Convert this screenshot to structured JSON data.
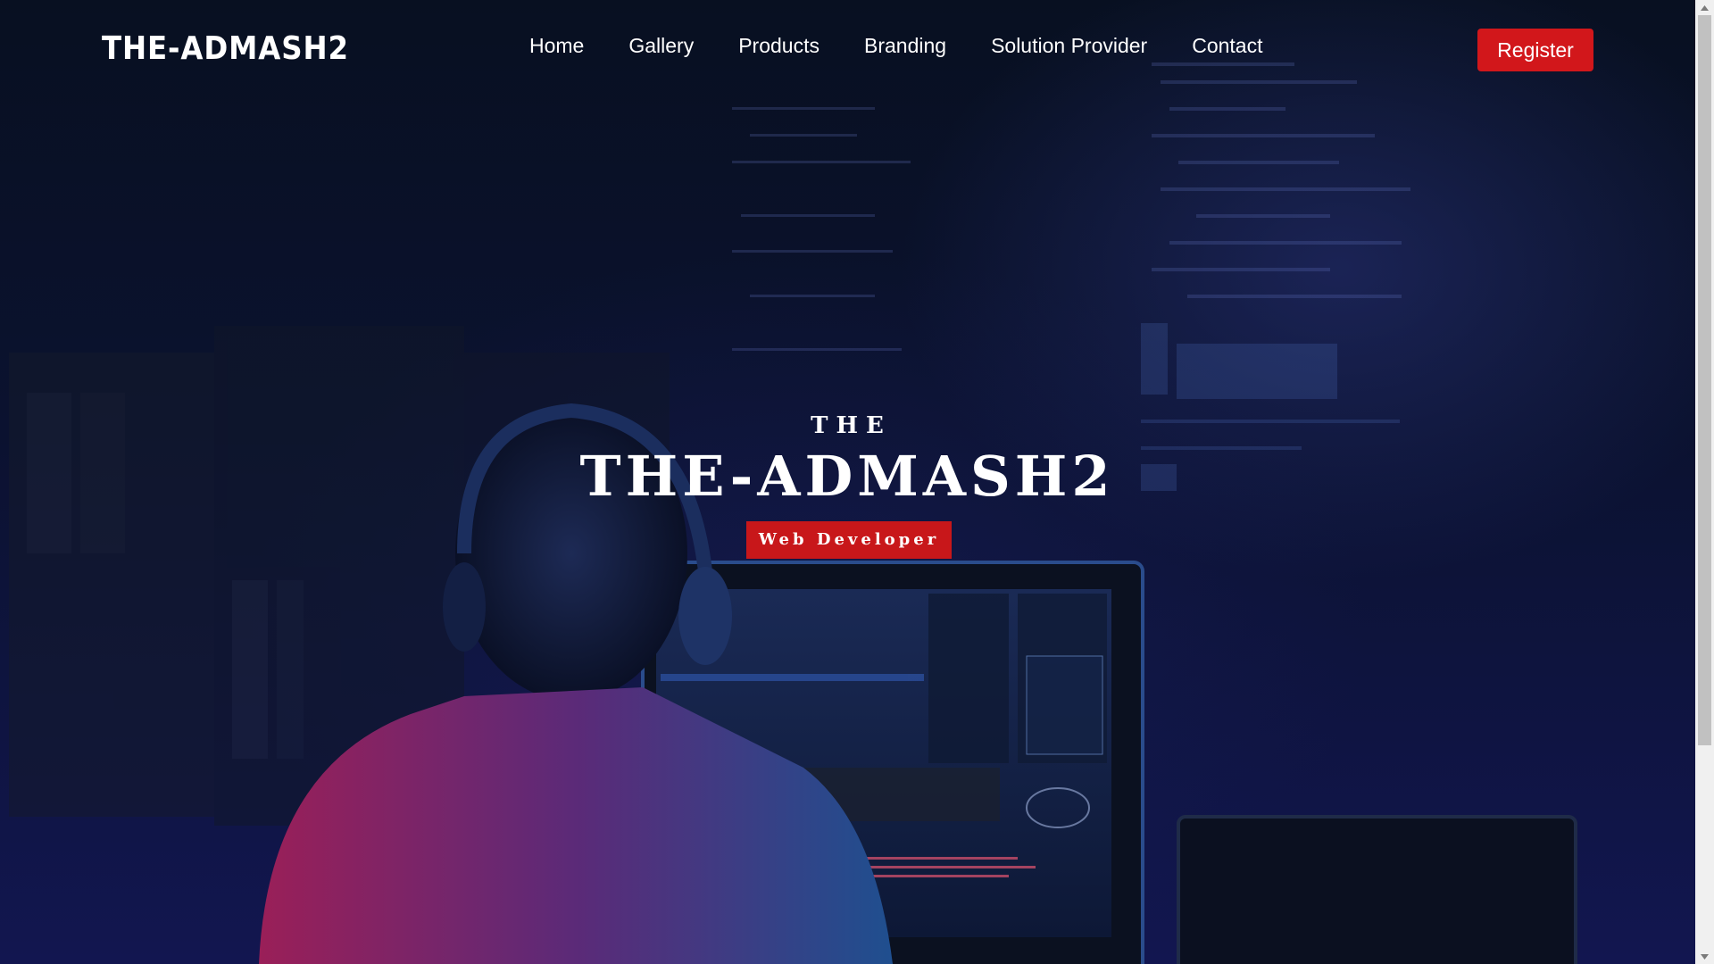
{
  "nav": {
    "brand": "THE-ADMASH2",
    "items": [
      {
        "label": "Home"
      },
      {
        "label": "Gallery"
      },
      {
        "label": "Products"
      },
      {
        "label": "Branding"
      },
      {
        "label": "Solution Provider"
      },
      {
        "label": "Contact"
      }
    ],
    "register_label": "Register"
  },
  "hero": {
    "kicker": "THE",
    "title": "THE-ADMASH2",
    "role": "Web Developer",
    "background": "developer-at-monitors-photo"
  },
  "colors": {
    "accent": "#d2171b",
    "text": "#ffffff",
    "background": "#0b1230"
  }
}
